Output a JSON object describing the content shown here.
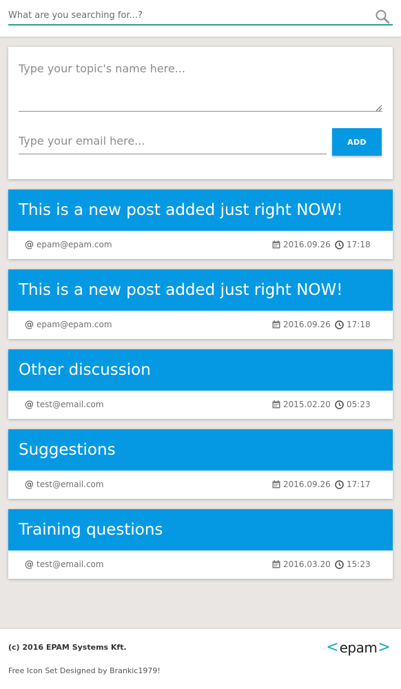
{
  "search": {
    "placeholder": "What are you searching for...?"
  },
  "form": {
    "topic_placeholder": "Type your topic's name here...",
    "email_placeholder": "Type your email here...",
    "add_label": "ADD"
  },
  "colors": {
    "accent": "#0699e3",
    "search_underline": "#2aa08a",
    "background": "#e9e6e3",
    "logo_accent": "#19a6c6"
  },
  "posts": [
    {
      "title": "This is a new post added just right NOW!",
      "at": "@",
      "email": "epam@epam.com",
      "date": "2016.09.26",
      "time": "17:18"
    },
    {
      "title": "This is a new post added just right NOW!",
      "at": "@",
      "email": "epam@epam.com",
      "date": "2016.09.26",
      "time": "17:18"
    },
    {
      "title": "Other discussion",
      "at": "@",
      "email": "test@email.com",
      "date": "2015.02.20",
      "time": "05:23"
    },
    {
      "title": "Suggestions",
      "at": "@",
      "email": "test@email.com",
      "date": "2016.09.26",
      "time": "17:17"
    },
    {
      "title": "Training questions",
      "at": "@",
      "email": "test@email.com",
      "date": "2016.03.20",
      "time": "15:23"
    }
  ],
  "icons": {
    "search": "search-icon",
    "calendar": "calendar-icon",
    "clock": "clock-icon"
  },
  "footer": {
    "copyright": "(c) 2016 EPAM Systems Kft.",
    "credit": "Free Icon Set Designed by Brankic1979!",
    "logo_left": "<",
    "logo_text": "epam",
    "logo_right": ">"
  }
}
